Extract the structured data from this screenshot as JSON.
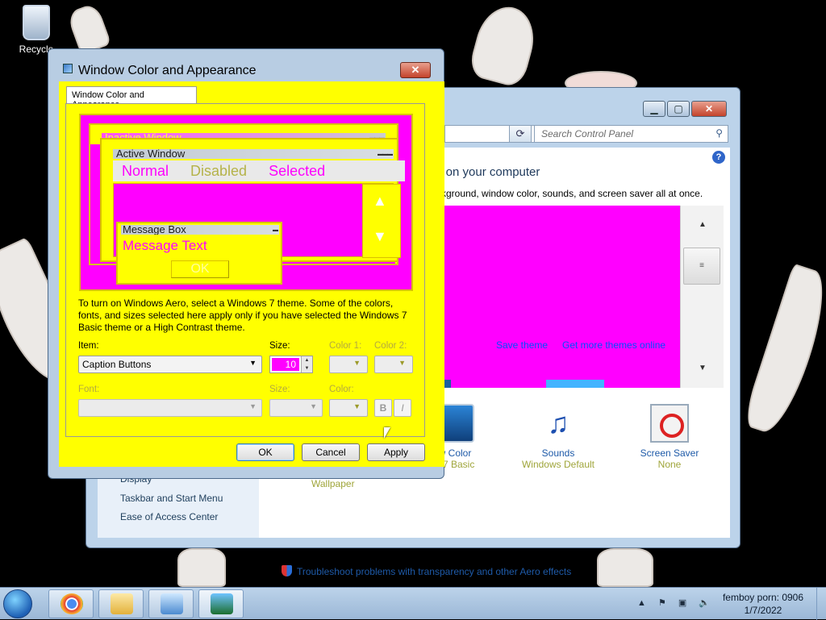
{
  "desktop": {
    "recycle_label": "Recycle"
  },
  "personalization": {
    "search_placeholder": "Search Control Panel",
    "heading": "s on your computer",
    "subheading": "ckground, window color, sounds, and screen saver all at once.",
    "save_theme": "Save theme",
    "get_more_themes": "Get more themes online",
    "sidebar": [
      "Display",
      "Taskbar and Start Menu",
      "Ease of Access Center"
    ],
    "tiles": [
      {
        "name": "w Color",
        "value": "s 7 Basic"
      },
      {
        "name": "Sounds",
        "value": "Windows Default"
      },
      {
        "name": "Screen Saver",
        "value": "None"
      }
    ],
    "wallpaper": "Wallpaper",
    "troubleshoot": "Troubleshoot problems with transparency and other Aero effects"
  },
  "dialog": {
    "title": "Window Color and Appearance",
    "tab": "Window Color and Appearance",
    "preview": {
      "inactive_window": "Inactive Window",
      "active_window": "Active Window",
      "menu_normal": "Normal",
      "menu_disabled": "Disabled",
      "menu_selected": "Selected",
      "message_box": "Message Box",
      "message_text": "Message Text",
      "ok": "OK"
    },
    "description": "To turn on Windows Aero, select a Windows 7 theme.  Some of the colors, fonts, and sizes selected here apply only if you have selected the Windows 7 Basic theme or a High Contrast theme.",
    "item_label": "Item:",
    "item_value": "Caption Buttons",
    "size_label": "Size:",
    "size_value": "10",
    "color1_label": "Color 1:",
    "color2_label": "Color 2:",
    "font_label": "Font:",
    "font_size_label": "Size:",
    "font_color_label": "Color:",
    "bold": "B",
    "italic": "I",
    "ok_button": "OK",
    "cancel_button": "Cancel",
    "apply_button": "Apply"
  },
  "taskbar": {
    "clock_line1": "femboy porn: 0906",
    "clock_line2": "1/7/2022",
    "tray_icons": "▲ ⚑ ▣ 🔈"
  },
  "colors": {
    "accent_magenta": "#ff00ff",
    "accent_yellow": "#ffff00"
  }
}
